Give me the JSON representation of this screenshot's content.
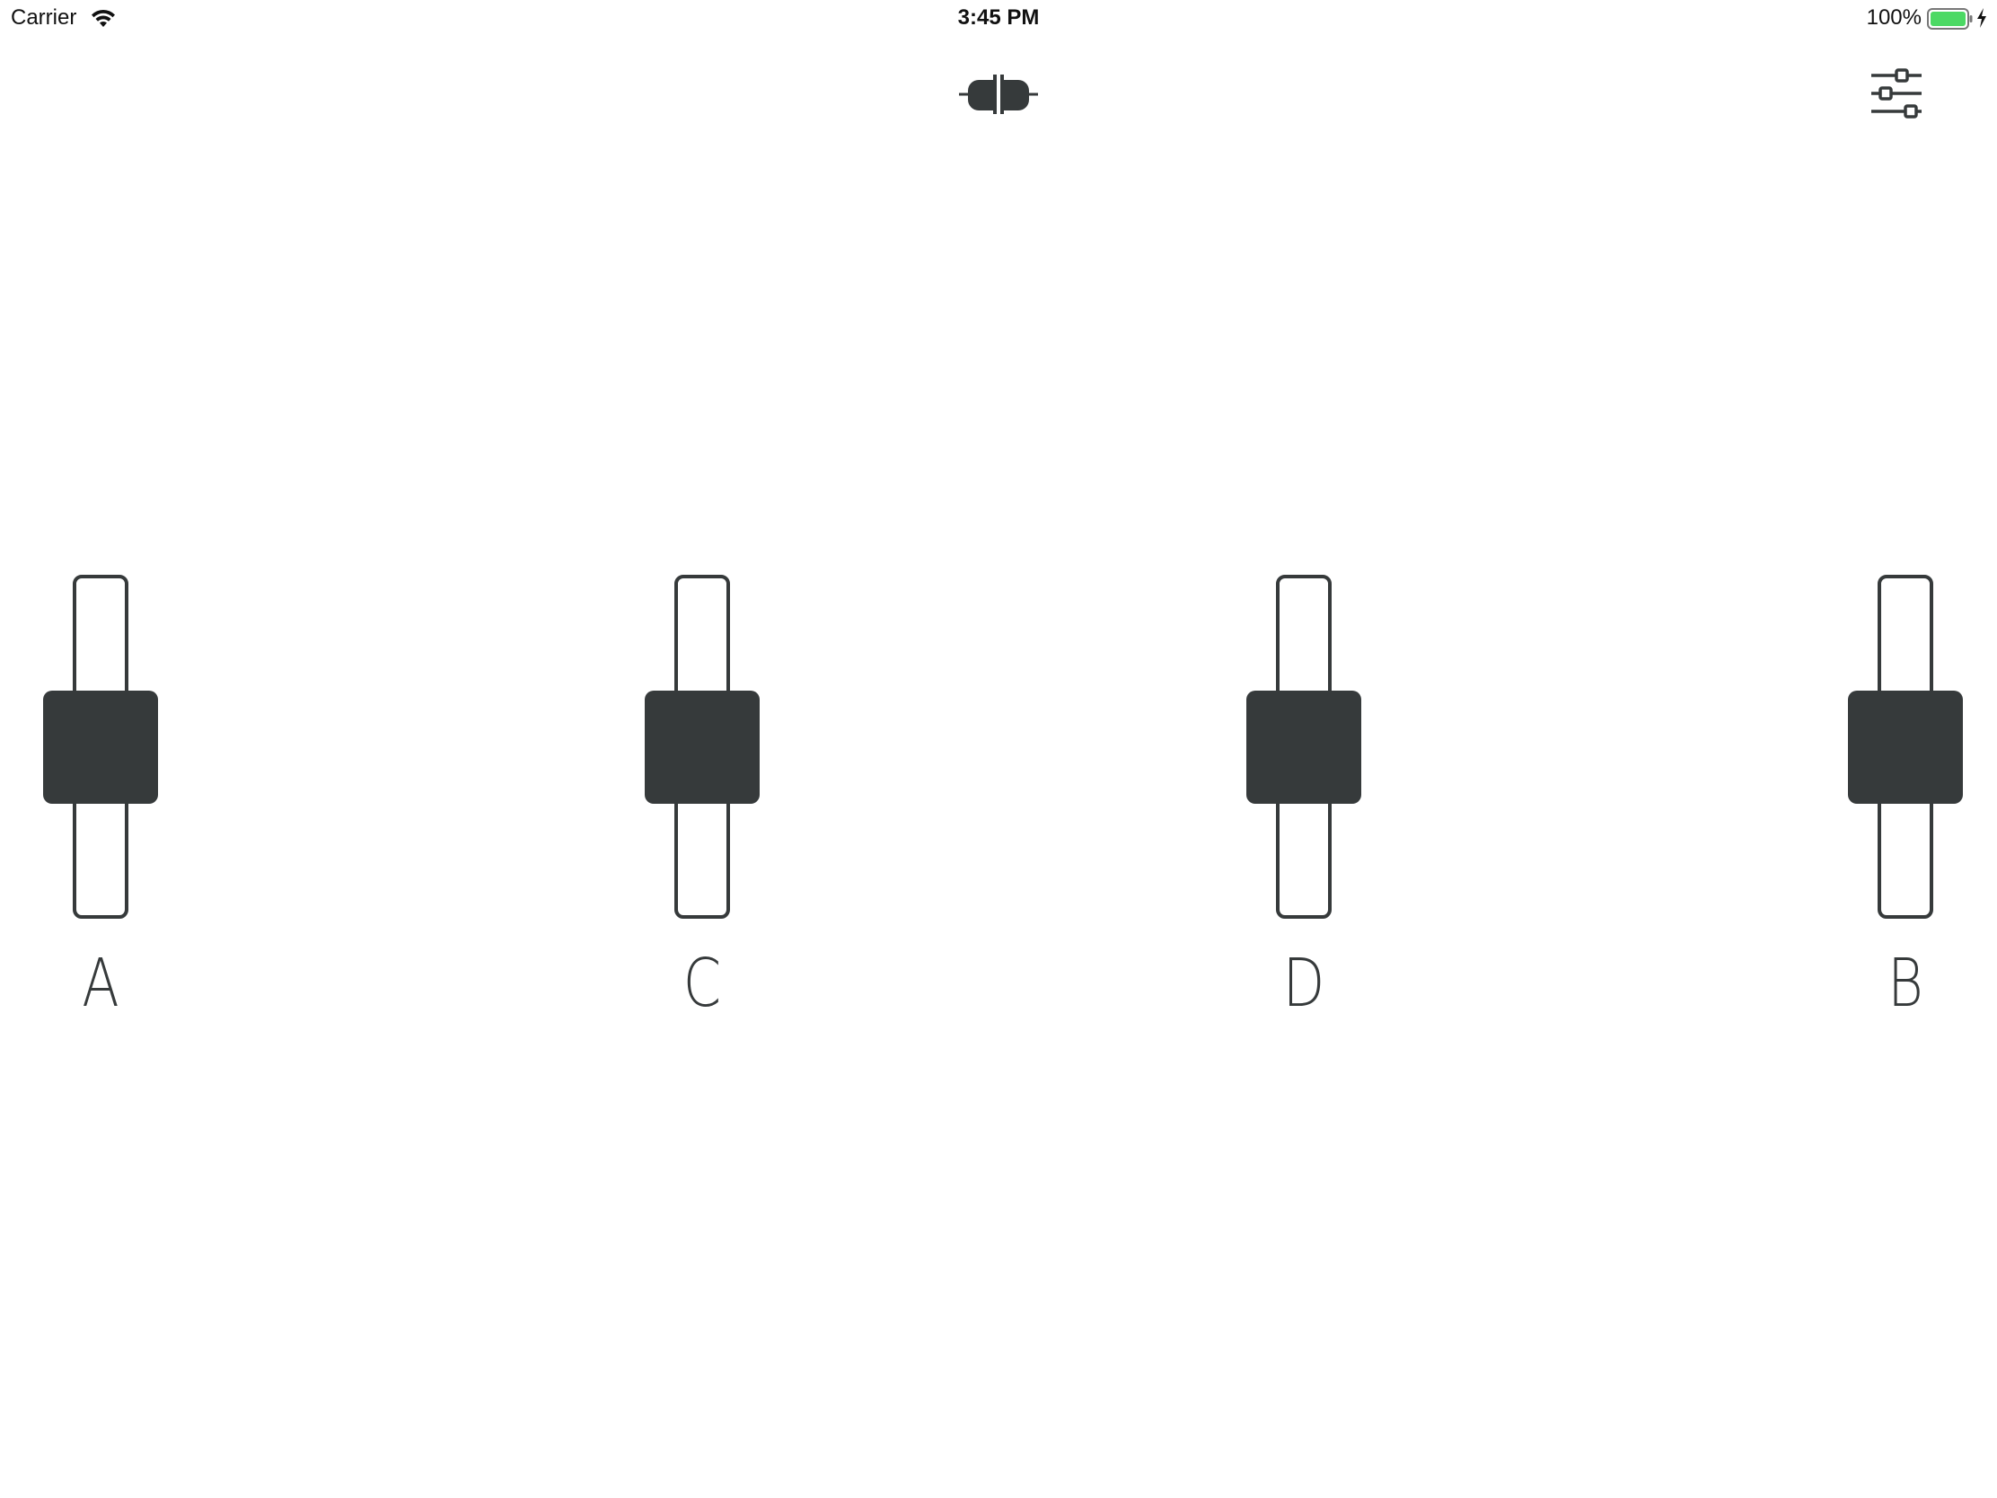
{
  "status_bar": {
    "carrier": "Carrier",
    "time": "3:45 PM",
    "battery_percent": "100%",
    "icons": [
      "wifi-icon",
      "battery-icon",
      "charging-bolt-icon"
    ],
    "battery_color": "#4cd964"
  },
  "toolbar": {
    "connect_icon": "plug-connector-icon",
    "settings_icon": "sliders-settings-icon"
  },
  "faders": [
    {
      "label": "A",
      "value": 0.5
    },
    {
      "label": "C",
      "value": 0.5
    },
    {
      "label": "D",
      "value": 0.5
    },
    {
      "label": "B",
      "value": 0.5
    }
  ],
  "colors": {
    "control": "#363a3b",
    "background": "#ffffff"
  }
}
